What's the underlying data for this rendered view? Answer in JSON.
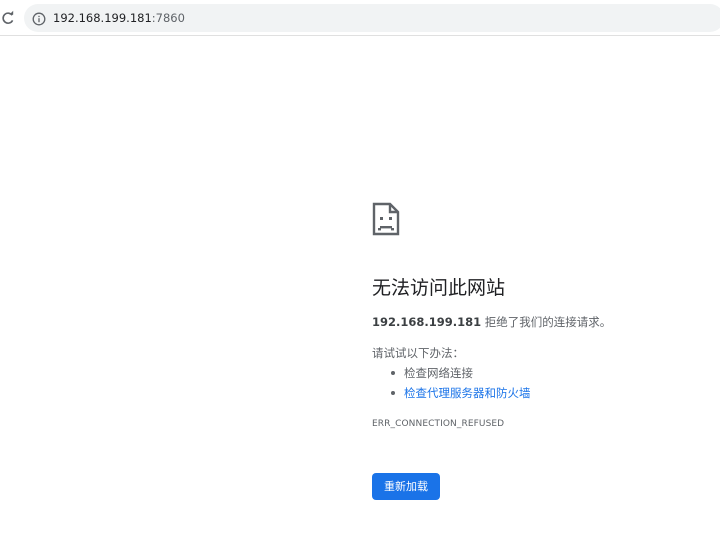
{
  "browser": {
    "url_host": "192.168.199.181",
    "url_port": ":7860",
    "reload_icon": "reload-icon",
    "info_icon": "info-icon"
  },
  "error_page": {
    "icon": "sad-page-icon",
    "title": "无法访问此网站",
    "summary_host": "192.168.199.181",
    "summary_rest": " 拒绝了我们的连接请求。",
    "try_label": "请试试以下办法：",
    "suggestions": [
      {
        "text": "检查网络连接",
        "is_link": false
      },
      {
        "text": "检查代理服务器和防火墙",
        "is_link": true
      }
    ],
    "error_code": "ERR_CONNECTION_REFUSED",
    "reload_button": "重新加载"
  },
  "colors": {
    "accent": "#1a73e8",
    "text_primary": "#202124",
    "text_secondary": "#5f6368",
    "omnibox_bg": "#f1f3f4"
  }
}
